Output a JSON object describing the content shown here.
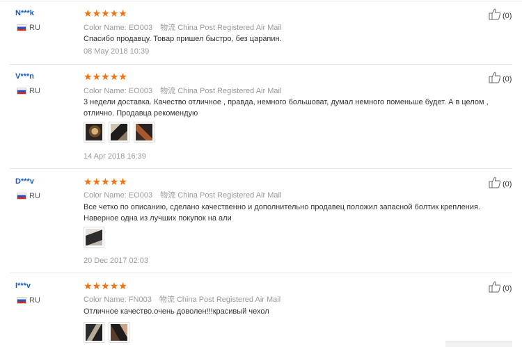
{
  "reviews": [
    {
      "user": "N***k",
      "country": "RU",
      "stars": "★★★★★",
      "color_label": "Color Name:",
      "color_value": "EO003",
      "logistics_label": "物流",
      "logistics_value": "China Post Registered Air Mail",
      "text": "Спасибо продавцу. Товар пришел быстро, без царапин.",
      "date": "08 May 2018 10:39",
      "helpful": "(0)",
      "photos": []
    },
    {
      "user": "V***n",
      "country": "RU",
      "stars": "★★★★★",
      "color_label": "Color Name:",
      "color_value": "EO003",
      "logistics_label": "物流",
      "logistics_value": "China Post Registered Air Mail",
      "text": "3 недели доставка. Качество отличное , правда, немного большоват, думал немного поменьше будет. А в целом , отлично. Продавца рекомендую",
      "date": "14 Apr 2018 16:39",
      "helpful": "(0)",
      "photos": [
        "photo-1",
        "photo-2",
        "photo-3"
      ]
    },
    {
      "user": "D***v",
      "country": "RU",
      "stars": "★★★★★",
      "color_label": "Color Name:",
      "color_value": "EO003",
      "logistics_label": "物流",
      "logistics_value": "China Post Registered Air Mail",
      "text": "Все четко по описанию, сделано качественно и дополнительно продавец положил запасной болтик крепления. Наверное одна из лучших покупок на али",
      "date": "20 Dec 2017 02:03",
      "helpful": "(0)",
      "photos": [
        "photo-1"
      ]
    },
    {
      "user": "I***v",
      "country": "RU",
      "stars": "★★★★★",
      "color_label": "Color Name:",
      "color_value": "FN003",
      "logistics_label": "物流",
      "logistics_value": "China Post Registered Air Mail",
      "text": "Отличное качество.очень доволен!!!красивый чехол",
      "date": "",
      "helpful": "(0)",
      "photos": [
        "photo-1",
        "photo-2"
      ]
    }
  ],
  "colors": {
    "star": "#f0730f",
    "username": "#1a5bbf",
    "muted": "#999999"
  },
  "icons": {
    "helpful": "thumbs-up-icon",
    "flag": "russia-flag-icon"
  }
}
